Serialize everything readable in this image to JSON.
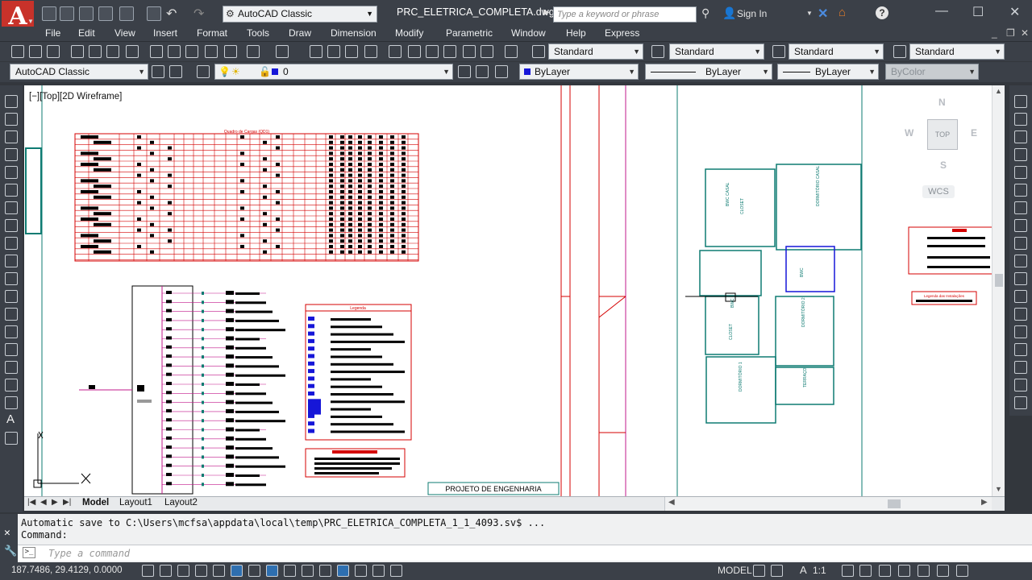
{
  "titlebar": {
    "workspace": "AutoCAD Classic",
    "document_title": "PRC_ELETRICA_COMPLETA.dwg",
    "search_placeholder": "Type a keyword or phrase",
    "signin": "Sign In"
  },
  "menu": [
    "File",
    "Edit",
    "View",
    "Insert",
    "Format",
    "Tools",
    "Draw",
    "Dimension",
    "Modify",
    "Parametric",
    "Window",
    "Help",
    "Express"
  ],
  "styles": {
    "text_style": "Standard",
    "dim_style": "Standard",
    "table_style": "Standard",
    "mleader_style": "Standard"
  },
  "layers": {
    "workspace_select": "AutoCAD Classic",
    "current_layer": "0",
    "color": "ByLayer",
    "linetype": "ByLayer",
    "lineweight": "ByLayer",
    "plotstyle": "ByColor"
  },
  "viewport": {
    "label": "[−][Top][2D Wireframe]",
    "viewcube": {
      "n": "N",
      "s": "S",
      "e": "E",
      "w": "W",
      "top": "TOP",
      "wcs": "WCS"
    }
  },
  "drawing": {
    "table_title": "Quadro de Cargas (QD1)",
    "legend_title": "Legenda",
    "legend2_title": "Legenda das Instalações",
    "title_block": "PROJETO DE ENGENHARIA",
    "rooms": [
      "CLOSET",
      "BWC CASAL",
      "DORMITÓRIO CASAL",
      "DORMITÓRIO 1",
      "DORMITÓRIO 2",
      "TERRAÇO",
      "CLOSET",
      "BWC",
      "BWC"
    ]
  },
  "tabs": [
    "Model",
    "Layout1",
    "Layout2"
  ],
  "command": {
    "history_1": "Automatic save to C:\\Users\\mcfsa\\appdata\\local\\temp\\PRC_ELETRICA_COMPLETA_1_1_4093.sv$ ...",
    "history_2": "Command:",
    "placeholder": "Type a command"
  },
  "status": {
    "coords": "187.7486, 29.4129, 0.0000",
    "model": "MODEL",
    "scale": "1:1"
  },
  "colors": {
    "accent": "#c8322a",
    "cad_red": "#d40000",
    "cad_teal": "#0e7b72",
    "cad_magenta": "#c2188b"
  }
}
